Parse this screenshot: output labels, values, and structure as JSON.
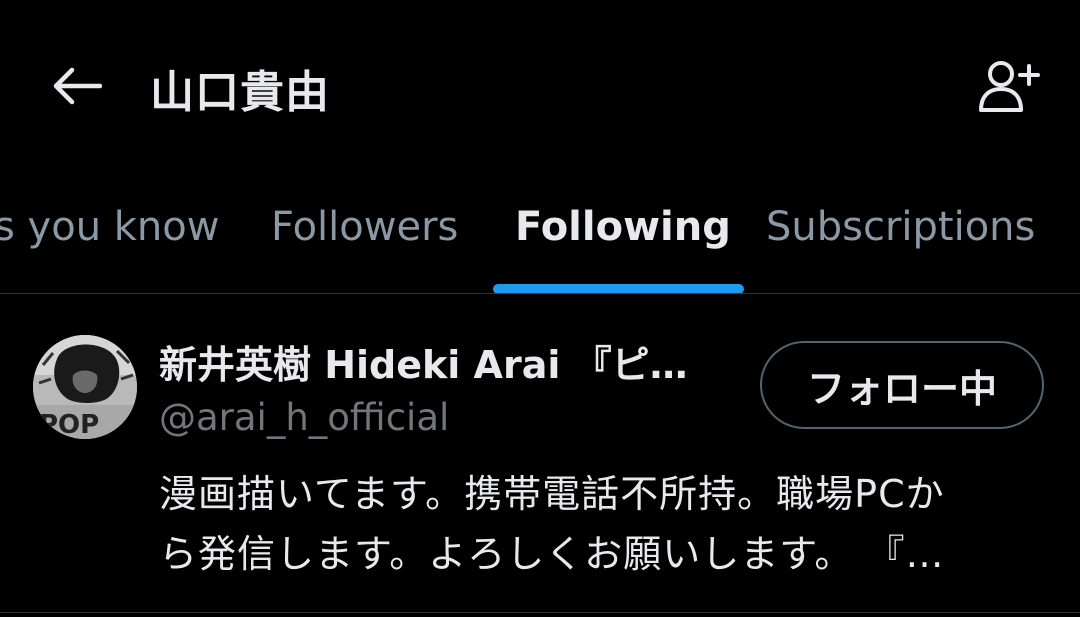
{
  "header": {
    "title": "山口貴由",
    "back_icon": "arrow-left-icon",
    "add_user_icon": "person-plus-icon"
  },
  "tabs": [
    {
      "label": "s you know",
      "active": false
    },
    {
      "label": "Followers",
      "active": false
    },
    {
      "label": "Following",
      "active": true
    },
    {
      "label": "Subscriptions",
      "active": false
    }
  ],
  "colors": {
    "accent": "#1d9bf0",
    "background": "#000000",
    "primary_text": "#e7e9ea",
    "secondary_text": "#71767b",
    "inactive_tab": "#8b98a5",
    "border": "#536471"
  },
  "users": [
    {
      "name": "新井英樹 Hideki Arai 『ピ…",
      "handle": "@arai_h_official",
      "follow_label": "フォロー中",
      "bio_lines": [
        "漫画描いてます。携帯電話不所持。職場PCか",
        "ら発信します。よろしくお願いします。 『…"
      ]
    }
  ]
}
